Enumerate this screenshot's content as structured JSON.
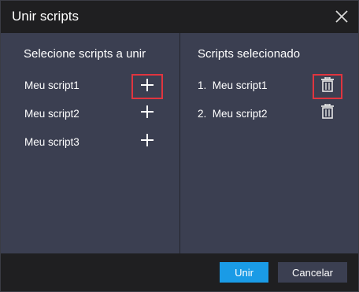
{
  "dialog": {
    "title": "Unir scripts",
    "close_icon": "close-icon"
  },
  "left_panel": {
    "heading": "Selecione scripts a unir",
    "items": [
      {
        "label": "Meu script1",
        "action_icon": "plus-icon",
        "highlighted": true
      },
      {
        "label": "Meu script2",
        "action_icon": "plus-icon",
        "highlighted": false
      },
      {
        "label": "Meu script3",
        "action_icon": "plus-icon",
        "highlighted": false
      }
    ]
  },
  "right_panel": {
    "heading": "Scripts selecionado",
    "items": [
      {
        "label": "1.  Meu script1",
        "action_icon": "trash-icon",
        "highlighted": true
      },
      {
        "label": "2.  Meu script2",
        "action_icon": "trash-icon",
        "highlighted": false
      }
    ]
  },
  "footer": {
    "primary_label": "Unir",
    "secondary_label": "Cancelar"
  },
  "colors": {
    "panel_bg": "#3b3f51",
    "dialog_bg": "#1f1f21",
    "accent": "#1a9be6",
    "highlight_border": "#e0353f"
  }
}
